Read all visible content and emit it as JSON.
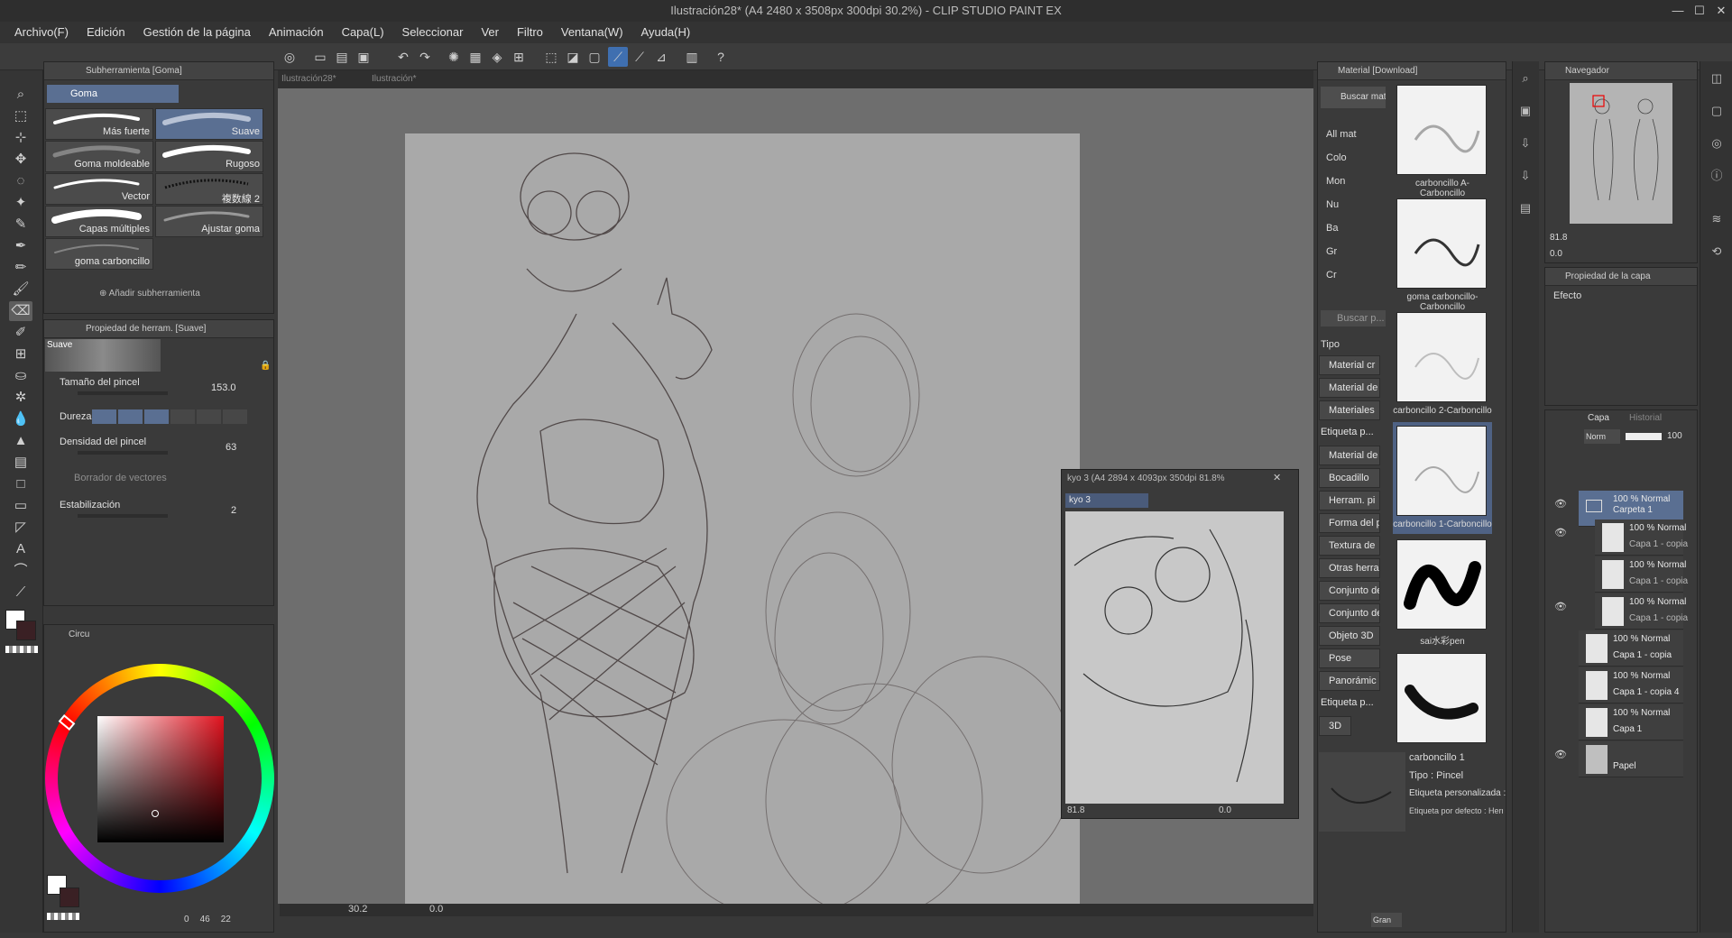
{
  "window": {
    "title": "Ilustración28* (A4 2480 x 3508px 300dpi 30.2%) - CLIP STUDIO PAINT EX",
    "minimize": "—",
    "maximize": "☐",
    "close": "✕"
  },
  "menu": [
    "Archivo(F)",
    "Edición",
    "Gestión de la página",
    "Animación",
    "Capa(L)",
    "Seleccionar",
    "Ver",
    "Filtro",
    "Ventana(W)",
    "Ayuda(H)"
  ],
  "doc_tabs": [
    "Ilustración28*",
    "Ilustración*"
  ],
  "subtool_panel": {
    "title": "Subherramienta [Goma]",
    "group": "Goma",
    "brushes": [
      "Más fuerte",
      "Suave",
      "Goma moldeable",
      "Rugoso",
      "Vector",
      "複数線 2",
      "Capas múltiples",
      "Ajustar goma",
      "goma carboncillo"
    ],
    "add_subtool": "Añadir subherramienta"
  },
  "tool_property": {
    "title": "Propiedad de herram. [Suave]",
    "preset": "Suave",
    "brush_size_label": "Tamaño del pincel",
    "brush_size_value": "153.0",
    "hardness_label": "Dureza",
    "density_label": "Densidad del pincel",
    "density_value": "63",
    "vector_eraser_label": "Borrador de vectores",
    "stabilization_label": "Estabilización",
    "stabilization_value": "2"
  },
  "color_panel": {
    "tab_label": "Circu",
    "status_values": [
      "0",
      "46",
      "22"
    ]
  },
  "canvas": {
    "zoom": "30.2",
    "rotation": "0.0"
  },
  "sub_view": {
    "title": "kyo 3 (A4 2894 x 4093px 350dpi 81.8%",
    "tab": "kyo 3",
    "zoom": "81.8",
    "rotation": "0.0"
  },
  "material_panel": {
    "title": "Material [Download]",
    "search_button": "Buscar mate",
    "tree": [
      "All mat",
      "Colo",
      "Mon",
      "Nu",
      "Ba",
      "Gr",
      "Cr"
    ],
    "search_placeholder": "Buscar p...",
    "type_label": "Tipo",
    "categories": [
      "Material cr",
      "Material de",
      "Materiales",
      "Etiqueta p...",
      "Material de",
      "Bocadillo",
      "Herram. pi",
      "Forma del p",
      "Textura de",
      "Otras herra",
      "Conjunto de",
      "Conjunto de",
      "Objeto 3D",
      "Pose",
      "Panorámic",
      "Etiqueta p...",
      "3D"
    ],
    "items": [
      "carboncillo A-Carboncillo",
      "goma carboncillo-Carboncillo",
      "carboncillo 2-Carboncillo",
      "carboncillo 1-Carboncillo",
      "sai水彩pen",
      ""
    ],
    "detail_name": "carboncillo 1",
    "detail_type": "Tipo : Pincel",
    "detail_tag": "Etiqueta personalizada :",
    "detail_default": "Etiqueta por defecto : Herram",
    "view_select": "Gran"
  },
  "navigator": {
    "title": "Navegador",
    "zoom": "81.8",
    "rotation": "0.0"
  },
  "layer_property": {
    "title": "Propiedad de la capa",
    "effect_label": "Efecto"
  },
  "layer_panel": {
    "tab_layer": "Capa",
    "tab_history": "Historial",
    "blend_mode": "Norm",
    "opacity": "100",
    "layers": [
      {
        "line1": "100 % Normal",
        "line2": "Carpeta 1"
      },
      {
        "line1": "100 % Normal",
        "line2": "Capa 1 - copia"
      },
      {
        "line1": "100 % Normal",
        "line2": "Capa 1 - copia"
      },
      {
        "line1": "100 % Normal",
        "line2": "Capa 1 - copia"
      },
      {
        "line1": "100 % Normal",
        "line2": "Capa 1 - copia"
      },
      {
        "line1": "100 % Normal",
        "line2": "Capa 1 - copia 4"
      },
      {
        "line1": "100 % Normal",
        "line2": "Capa 1"
      },
      {
        "line1": "",
        "line2": "Papel"
      }
    ]
  },
  "colors": {
    "accent": "#3f6fb0",
    "selection": "#5a6f92",
    "panel": "#3a3a3a",
    "main_color": "#ffffff",
    "sub_color": "#3a2024"
  }
}
